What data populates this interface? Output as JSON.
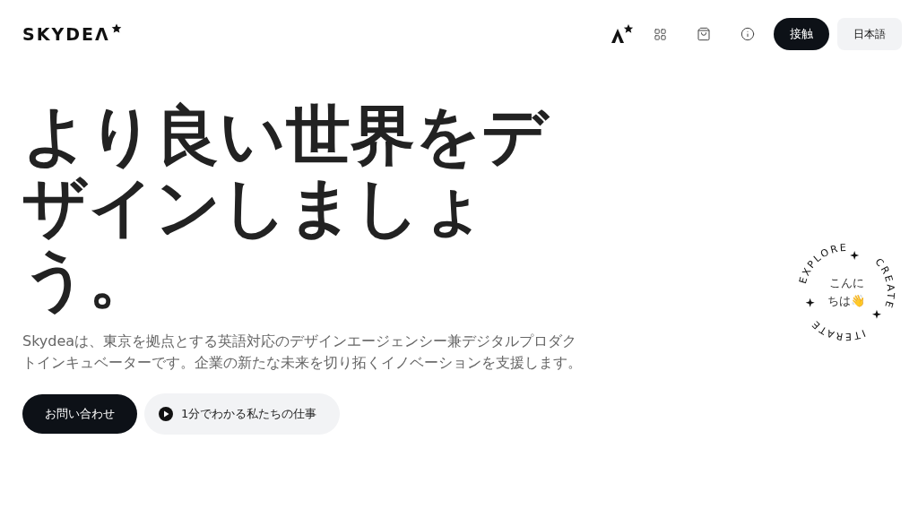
{
  "header": {
    "logo": "SKYDEΛ",
    "contact_button": "接触",
    "language_button": "日本語"
  },
  "hero": {
    "heading": "より良い世界をデザインしましょう。",
    "description": "Skydeaは、東京を拠点とする英語対応のデザインエージェンシー兼デジタルプロダクトインキュベーターです。企業の新たな未来を切り拓くイノベーションを支援します。",
    "primary_button": "お問い合わせ",
    "video_button": "1分でわかる私たちの仕事"
  },
  "badge": {
    "words": [
      "EXPLORE",
      "CREATE",
      "ITERATE"
    ],
    "greeting": "こんにちは👋"
  }
}
